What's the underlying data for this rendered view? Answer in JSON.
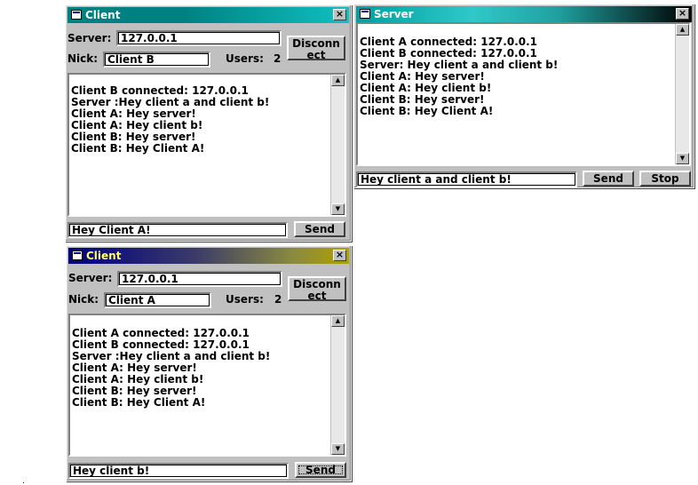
{
  "client_b": {
    "title": "Client",
    "close": "×",
    "server_label": "Server:",
    "server_value": "127.0.0.1",
    "nick_label": "Nick:",
    "nick_value": "Client B",
    "users_label": "Users:",
    "users_count": "2",
    "disconnect_line1": "Disconn",
    "disconnect_line2": "ect",
    "log": [
      "Client B connected: 127.0.0.1",
      "Server :Hey client a and client b!",
      "Client A: Hey server!",
      "Client A: Hey client b!",
      "Client B: Hey server!",
      "Client B: Hey Client A!"
    ],
    "message_value": "Hey Client A!",
    "send_label": "Send"
  },
  "server": {
    "title": "Server",
    "close": "×",
    "log": [
      "Client A connected: 127.0.0.1",
      "Client B connected: 127.0.0.1",
      "Server: Hey client a and client b!",
      "Client A: Hey server!",
      "Client A: Hey client b!",
      "Client B: Hey server!",
      "Client B: Hey Client A!"
    ],
    "message_value": "Hey client a and client b!",
    "send_label": "Send",
    "stop_label": "Stop"
  },
  "client_a": {
    "title": "Client",
    "close": "×",
    "server_label": "Server:",
    "server_value": "127.0.0.1",
    "nick_label": "Nick:",
    "nick_value": "Client A",
    "users_label": "Users:",
    "users_count": "2",
    "disconnect_line1": "Disconn",
    "disconnect_line2": "ect",
    "log": [
      "Client A connected: 127.0.0.1",
      "Client B connected: 127.0.0.1",
      "Server :Hey client a and client b!",
      "Client A: Hey server!",
      "Client A: Hey client b!",
      "Client B: Hey server!",
      "Client B: Hey Client A!"
    ],
    "message_value": "Hey client b!",
    "send_label": "Send"
  },
  "icons": {
    "scroll_up": "▲",
    "scroll_down": "▼",
    "app_icon": "window-app-icon"
  },
  "colors": {
    "active_title": "#008080",
    "inactive_title": "#000080",
    "window_face": "#c0c0c0"
  }
}
